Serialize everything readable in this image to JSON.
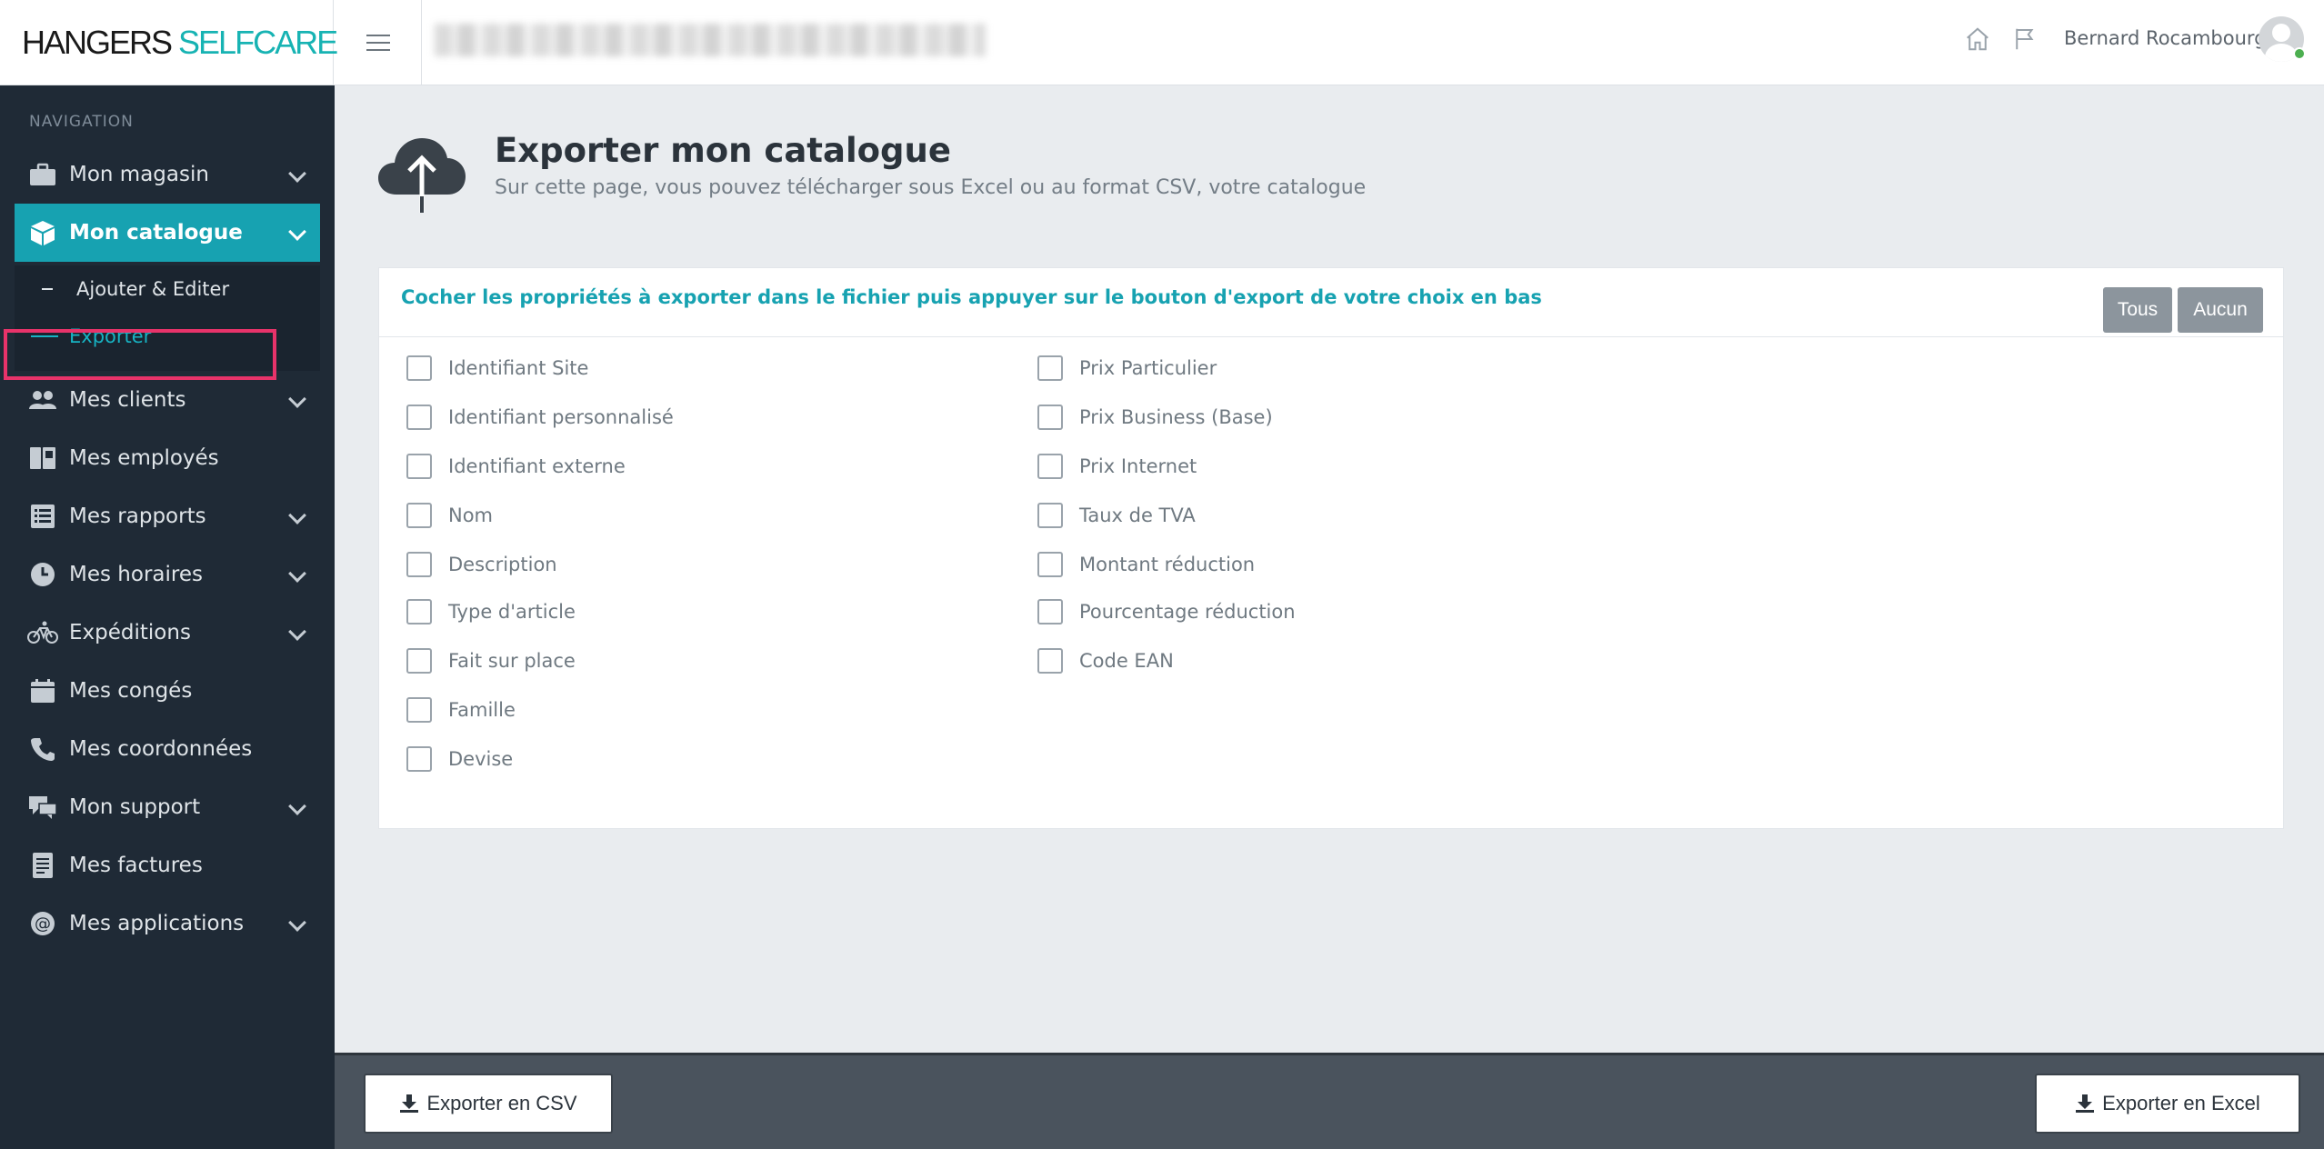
{
  "header": {
    "logo_part1": "HANGERS",
    "logo_part2": "SELFCARE",
    "user_name": "Bernard Rocambourg"
  },
  "sidebar": {
    "nav_title": "NAVIGATION",
    "items": [
      {
        "label": "Mon magasin",
        "icon": "briefcase-icon"
      },
      {
        "label": "Mon catalogue",
        "icon": "box-icon"
      },
      {
        "label": "Mes clients",
        "icon": "users-icon"
      },
      {
        "label": "Mes employés",
        "icon": "id-badge-icon"
      },
      {
        "label": "Mes rapports",
        "icon": "list-icon"
      },
      {
        "label": "Mes horaires",
        "icon": "clock-icon"
      },
      {
        "label": "Expéditions",
        "icon": "bicycle-icon"
      },
      {
        "label": "Mes congés",
        "icon": "calendar-icon"
      },
      {
        "label": "Mes coordonnées",
        "icon": "phone-icon"
      },
      {
        "label": "Mon support",
        "icon": "comments-icon"
      },
      {
        "label": "Mes factures",
        "icon": "invoice-icon"
      },
      {
        "label": "Mes applications",
        "icon": "at-icon"
      }
    ],
    "submenu": [
      "Ajouter & Editer",
      "Exporter"
    ]
  },
  "page": {
    "title": "Exporter mon catalogue",
    "subtitle": "Sur cette page, vous pouvez télécharger sous Excel ou au format CSV, votre catalogue"
  },
  "card": {
    "instruction": "Cocher les propriétés à exporter dans le fichier puis appuyer sur le bouton d'export de votre choix en bas",
    "btn_all": "Tous",
    "btn_none": "Aucun",
    "left_options": [
      "Identifiant Site",
      "Identifiant personnalisé",
      "Identifiant externe",
      "Nom",
      "Description",
      "Type d'article",
      "Fait sur place",
      "Famille",
      "Devise"
    ],
    "right_options": [
      "Prix Particulier",
      "Prix Business (Base)",
      "Prix Internet",
      "Taux de TVA",
      "Montant réduction",
      "Pourcentage réduction",
      "Code EAN"
    ]
  },
  "footer": {
    "export_csv": "Exporter en CSV",
    "export_excel": "Exporter en Excel"
  },
  "colors": {
    "accent": "#17a2b1",
    "sidebar_bg": "#1f2a36",
    "highlight": "#e8336a"
  }
}
